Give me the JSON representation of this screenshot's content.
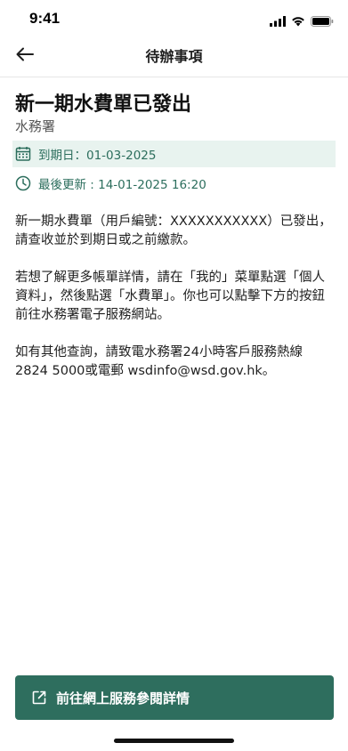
{
  "status_bar": {
    "time": "9:41"
  },
  "nav": {
    "title": "待辦事項",
    "back_icon": "arrow-left-icon"
  },
  "notice": {
    "title": "新一期水費單已發出",
    "department": "水務署",
    "due_date": "到期日：01-03-2025",
    "last_updated": "最後更新 : 14-01-2025 16:20",
    "paragraphs": [
      "新一期水費單（用戶編號：XXXXXXXXXXX）已發出，請查收並於到期日或之前繳款。",
      "若想了解更多帳單詳情，請在「我的」菜單點選「個人資料」，然後點選「水費單」。你也可以點擊下方的按鈕前往水務署電子服務網站。",
      "如有其他查詢，請致電水務署24小時客戶服務熱線2824 5000或電郵 wsdinfo@wsd.gov.hk。"
    ]
  },
  "action": {
    "button_label": "前往網上服務參閱詳情",
    "icon": "external-link-icon"
  },
  "colors": {
    "accent": "#2e6e5e",
    "accent_text": "#2c6e5d",
    "highlight_bg": "#e8f3ef"
  }
}
